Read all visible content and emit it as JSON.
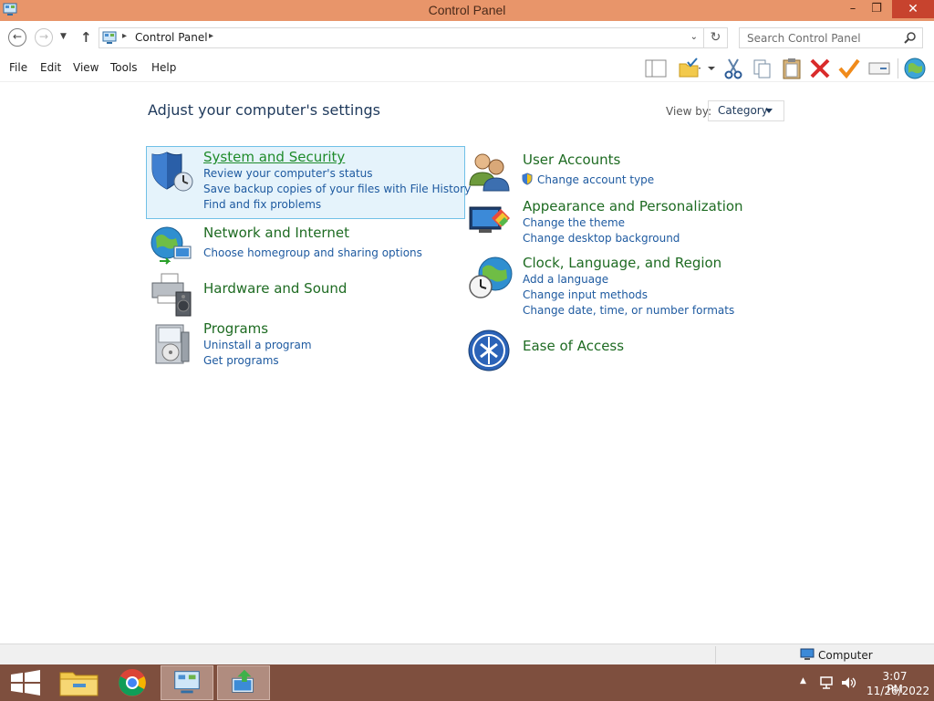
{
  "window": {
    "title": "Control Panel",
    "minimize_glyph": "–",
    "maximize_glyph": "❐",
    "close_glyph": "✕"
  },
  "address": {
    "back_glyph": "←",
    "forward_glyph": "→",
    "recent_glyph": "▼",
    "up_glyph": "↑",
    "breadcrumb": "Control Panel",
    "separator_glyph": "▸",
    "dropdown_glyph": "⌄",
    "refresh_glyph": "↻",
    "search_placeholder": "Search Control Panel"
  },
  "menu": {
    "items": [
      "File",
      "Edit",
      "View",
      "Tools",
      "Help"
    ]
  },
  "toolbar": {
    "icons": [
      "layout-icon",
      "folder-check-icon",
      "cut-icon",
      "copy-icon",
      "paste-icon",
      "delete-icon",
      "checkmark-icon",
      "properties-icon",
      "globe-icon"
    ]
  },
  "main": {
    "heading": "Adjust your computer's settings",
    "view_by_label": "View by:",
    "view_by_value": "Category",
    "categories": [
      {
        "title": "System and Security",
        "icon": "shield-icon",
        "links": [
          "Review your computer's status",
          "Save backup copies of your files with File History",
          "Find and fix problems"
        ]
      },
      {
        "title": "Network and Internet",
        "icon": "network-globe-icon",
        "links": [
          "Choose homegroup and sharing options"
        ]
      },
      {
        "title": "Hardware and Sound",
        "icon": "printer-speaker-icon",
        "links": []
      },
      {
        "title": "Programs",
        "icon": "programs-icon",
        "links": [
          "Uninstall a program",
          "Get programs"
        ]
      },
      {
        "title": "User Accounts",
        "icon": "users-icon",
        "links": [
          "Change account type"
        ]
      },
      {
        "title": "Appearance and Personalization",
        "icon": "monitor-palette-icon",
        "links": [
          "Change the theme",
          "Change desktop background"
        ]
      },
      {
        "title": "Clock, Language, and Region",
        "icon": "clock-globe-icon",
        "links": [
          "Add a language",
          "Change input methods",
          "Change date, time, or number formats"
        ]
      },
      {
        "title": "Ease of Access",
        "icon": "ease-of-access-icon",
        "links": []
      }
    ]
  },
  "statusbar": {
    "zone": "Computer"
  },
  "taskbar": {
    "apps": [
      "windows-start-icon",
      "file-explorer-icon",
      "chrome-icon",
      "control-panel-icon",
      "network-app-icon"
    ],
    "tray_up_glyph": "▲",
    "time": "3:07 PM",
    "date": "11/26/2022"
  },
  "colors": {
    "titlebar": "#e8956a",
    "close_button": "#c7432e",
    "category_title": "#1e6b22",
    "link": "#1e5aa0",
    "heading": "#1e395b",
    "selection_bg": "#e5f3fb",
    "selection_border": "#70c0e7",
    "taskbar": "#7e4f3e"
  }
}
